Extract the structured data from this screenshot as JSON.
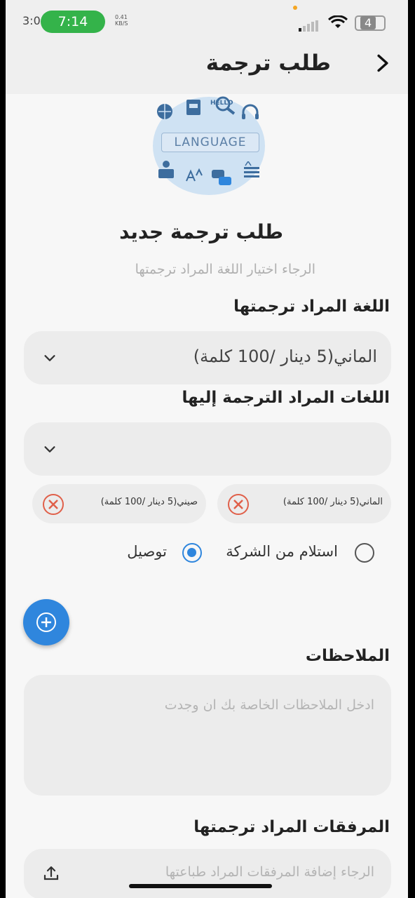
{
  "status_bar": {
    "left_time": "3:0",
    "time": "7:14",
    "net_speed": "0.41",
    "net_unit": "KB/S",
    "battery": "4"
  },
  "appbar": {
    "title": "طلب ترجمة",
    "back_icon": "chevron-right-icon"
  },
  "hero": {
    "word": "LANGUAGE",
    "small_text": "HELLO",
    "icons": [
      "globe-icon",
      "book-icon",
      "magnifier-icon",
      "headphones-icon",
      "reader-icon",
      "translate-icon",
      "chat-icon",
      "text-size-icon"
    ]
  },
  "header": {
    "title": "طلب ترجمة جديد",
    "subtitle": "الرجاء اختيار اللغة المراد ترجمتها"
  },
  "source_language": {
    "label": "اللغة المراد ترجمتها",
    "value": "الماني(5 دينار /100 كلمة)"
  },
  "target_languages": {
    "label": "اللغات المراد الترجمة إليها",
    "value": "",
    "chips": [
      {
        "label": "الماني(5 دينار /100 كلمة)"
      },
      {
        "label": "صيني(5 دينار /100 كلمة)"
      }
    ]
  },
  "delivery": {
    "options": [
      {
        "label": "استلام من الشركة",
        "selected": false
      },
      {
        "label": "توصيل",
        "selected": true
      }
    ]
  },
  "notes": {
    "label": "الملاحظات",
    "placeholder": "ادخل الملاحظات الخاصة بك ان وجدت"
  },
  "attachments": {
    "label": "المرفقات المراد ترجمتها",
    "placeholder": "الرجاء إضافة المرفقات المراد طباعتها"
  },
  "colors": {
    "accent": "#2f86dd",
    "remove": "#e0604a",
    "status_pill": "#34b34a"
  }
}
